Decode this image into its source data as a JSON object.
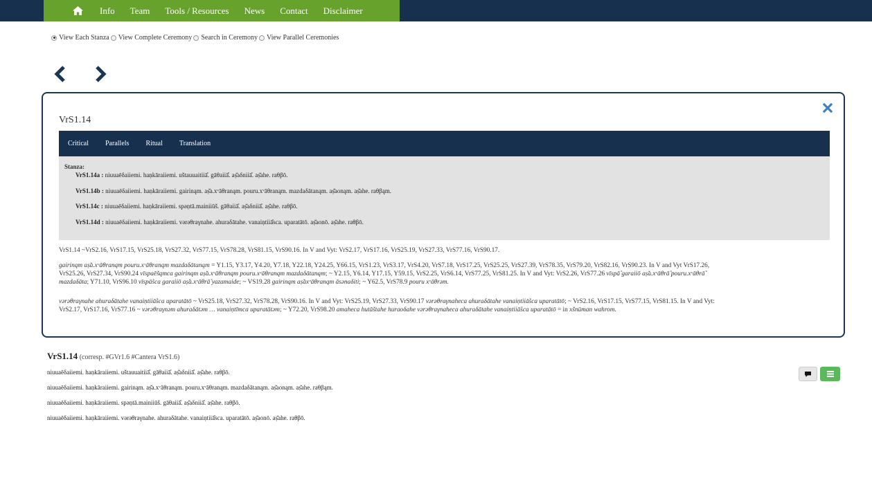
{
  "nav": {
    "items": [
      "Info",
      "Team",
      "Tools / Resources",
      "News",
      "Contact",
      "Disclaimer"
    ]
  },
  "view_options": [
    {
      "label": "View Each Stanza",
      "selected": true
    },
    {
      "label": "View Complete Ceremony",
      "selected": false
    },
    {
      "label": "Search in Ceremony",
      "selected": false
    },
    {
      "label": "View Parallel Ceremonies",
      "selected": false
    }
  ],
  "panel": {
    "title": "VrS1.14",
    "tabs": [
      "Critical",
      "Parallels",
      "Ritual",
      "Translation"
    ],
    "stanza_header": "Stanza:",
    "stanza_lines": [
      {
        "id": "VrS1.14a :",
        "text": " niuuaēδaiiemi. haṇkāraiiemi. uštauuaitiiā̊. gāθaiiā̊. aṣ̌aδniiā̊. aṣ̌ahe. raθβō."
      },
      {
        "id": "VrS1.14b :",
        "text": " niuuaēδaiiemi. haṇkāraiiemi. gairinąm. aṣ̌a.xᵛāθranąm. pouru.xᵛāθranąm. mazdaδātanąm. aṣ̌aonąm. aṣ̌ahe. raθβąm."
      },
      {
        "id": "VrS1.14c :",
        "text": " niuuaēδaiiemi. haṇkāraiiemi. spəṇtā.mainiiūš. gāθaiiā̊. aṣ̌aδniiā̊. aṣ̌ahe. raθβō."
      },
      {
        "id": "VrS1.14d :",
        "text": " niuuaēδaiiemi. haṇkāraiiemi. vərəθraγnahe. ahuraδātahe. vanaiṇtiiā̊sca. uparatātō. aṣ̌aonō. aṣ̌ahe. raθβō."
      }
    ],
    "parallels_intro": "VrS1.14 ~VrS2.16, VrS17.15, VrS25.18, VrS27.32, VrS77.15, VrS78.28, VrS81.15, VrS90.16. In V and Vyt: VrS2.17, VrS17.16, VrS25.19, VrS27.33, VrS77.16, VrS90.17.",
    "para2": [
      {
        "t": "gairinąm aṣ̌a.xᵛāθranąm pouru.xᵛāθranąm mazdaδātanąm",
        "i": true
      },
      {
        "t": " = Y1.15, Y3.17, Y4.20, Y7.18, Y22.18, Y24.25, Y66.15, VrS1.23, VrS3.17, VrS4.20, VrS7.18, VrS17.25, VrS25.25, VrS27.39, VrS78.35, VrS79.20, VrS82.16, VrS90.23. In V and Vyt VrS17.26,",
        "i": false
      }
    ],
    "para2b": [
      {
        "t": "VrS25.26, VrS27.34, VrS90.24 ",
        "i": false
      },
      {
        "t": "vīspaēšąmca gairinąm aṣ̌a.xᵛāθranąm pouru.xᵛāθranąm mazdaδātanąm",
        "i": true
      },
      {
        "t": "; ~ Y2.15, Y6.14, Y17.15, Y59.15, VrS2.25, VrS6.14, VrS77.25, VrS81.25. In V and Vyt: VrS2.26, VrS77.26 ",
        "i": false
      },
      {
        "t": "vīspā̊ garaiiō aṣ̌a.xᵛāθrā̊ pouru.xᵛāθrā̊",
        "i": true
      }
    ],
    "para2c": [
      {
        "t": "mazdaδāta",
        "i": true
      },
      {
        "t": "; Y71.10, VrS96.10 ",
        "i": false
      },
      {
        "t": "vīspā̊sca garaiiō aṣ̌a.xᵛāθrā̊ yazamaide",
        "i": true
      },
      {
        "t": "; ~ VS19.28 ",
        "i": false
      },
      {
        "t": "gairinąm aṣ̌axᵛāθranąm āsənaδiti",
        "i": true
      },
      {
        "t": "; ~ Y62.5, VrS78.9 ",
        "i": false
      },
      {
        "t": "pouru xᵛāθrəm.",
        "i": true
      }
    ],
    "para3": [
      {
        "t": "vərəθraγnahe ahuraδātahe vanaiṇtiiā̊sca uparatātō",
        "i": true
      },
      {
        "t": " ~ VrS25.18, VrS27.32, VrS78.28, VrS90.16. In V and Vyt: VrS25.19, VrS27.33, VrS90.17 ",
        "i": false
      },
      {
        "t": "vərəθraγnaheca ahuraδātahe vanaiṇtiiā̊sca uparatātō",
        "i": true
      },
      {
        "t": "; ~ VrS2.16, VrS17.15, VrS77.15, VrS81.15. In V and Vyt:",
        "i": false
      }
    ],
    "para3b": [
      {
        "t": "VrS2.17, VrS17.16, VrS77.16 ~ ",
        "i": false
      },
      {
        "t": "vərəθraγnəm ahuraδātəm … vanaiṇtīmca uparatātəm",
        "i": true
      },
      {
        "t": "; ~ Y72.20, VrS98.20 ",
        "i": false
      },
      {
        "t": "amaheca hutāštahe huraoδahe vərəθraγnaheca ahuraδātahe vanaiṇtiiā̊sca uparatātō",
        "i": true
      },
      {
        "t": " = in ",
        "i": false
      },
      {
        "t": "xšnūman wahrom.",
        "i": true
      }
    ]
  },
  "lower": {
    "title": "VrS1.14",
    "subtitle": " (corresp. #GVr1.6 #Cantera VrS1.6)",
    "lines": [
      "niuuaēδaiiemi. haṇkāraiiemi. uštauuaitiiā̊. gāθaiiā̊. aṣ̌aδniiā̊. aṣ̌ahe. raθβō.",
      "niuuaēδaiiemi. haṇkāraiiemi. gairinąm. aṣ̌a.xᵛāθranąm. pouru.xᵛāθranąm. mazdaδātanąm. aṣ̌aonąm. aṣ̌ahe. raθβąm.",
      "niuuaēδaiiemi. haṇkāraiiemi. spəṇtā.mainiiūš. gāθaiiā̊. aṣ̌aδniiā̊. aṣ̌ahe. raθβō.",
      "niuuaēδaiiemi. haṇkāraiiemi. vərəθraγnahe. ahuraδātahe. vanaiṇtiiā̊sca. uparatātō. aṣ̌aonō. aṣ̌ahe. raθβō."
    ]
  },
  "colors": {
    "nav_green": "#67a22d",
    "navy": "#17304d",
    "close_blue": "#3a83c1",
    "btn_green": "#5cb85c"
  },
  "icons": {
    "home": "home-icon",
    "prev": "chevron-left-icon",
    "next": "chevron-right-icon",
    "close": "close-icon",
    "comment": "comment-icon",
    "list": "list-icon"
  }
}
